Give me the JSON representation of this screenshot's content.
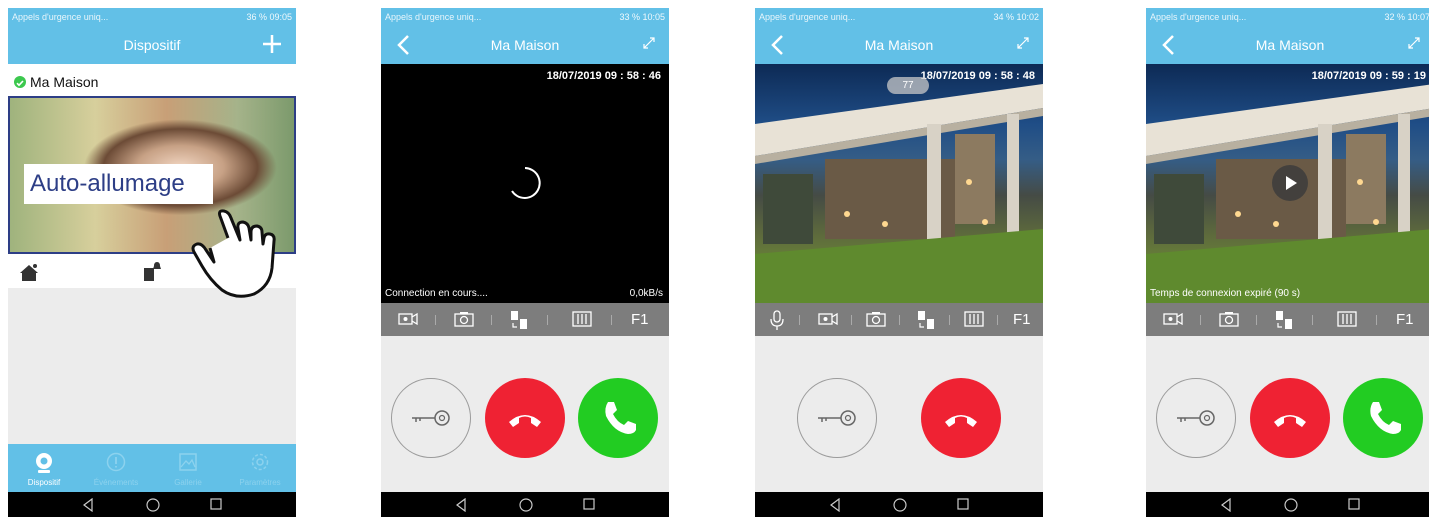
{
  "screens": [
    {
      "status_left": "Appels d'urgence uniq...",
      "status_right": "36 % 09:05",
      "title": "Dispositif",
      "device_name": "Ma Maison",
      "overlay_label": "Auto-allumage",
      "nav": [
        "Dispositif",
        "Événements",
        "Gallerie",
        "Paramètres"
      ]
    },
    {
      "status_left": "Appels d'urgence uniq...",
      "status_right": "33 % 10:05",
      "title": "Ma Maison",
      "timestamp": "18/07/2019  09 : 58 : 46",
      "connection": "Connection en cours....",
      "rate": "0,0kB/s",
      "f1": "F1"
    },
    {
      "status_left": "Appels d'urgence uniq...",
      "status_right": "34 % 10:02",
      "title": "Ma Maison",
      "timestamp": "18/07/2019  09 : 58 : 48",
      "badge": "77",
      "f1": "F1"
    },
    {
      "status_left": "Appels d'urgence uniq...",
      "status_right": "32 % 10:07",
      "title": "Ma Maison",
      "timestamp": "18/07/2019  09 : 59 : 19",
      "expired": "Temps de connexion expiré (90 s)",
      "f1": "F1"
    }
  ],
  "colors": {
    "accent": "#62c0e7",
    "hangup": "#ef2233",
    "answer": "#22cc22",
    "toolbar": "#7d7d7d"
  }
}
